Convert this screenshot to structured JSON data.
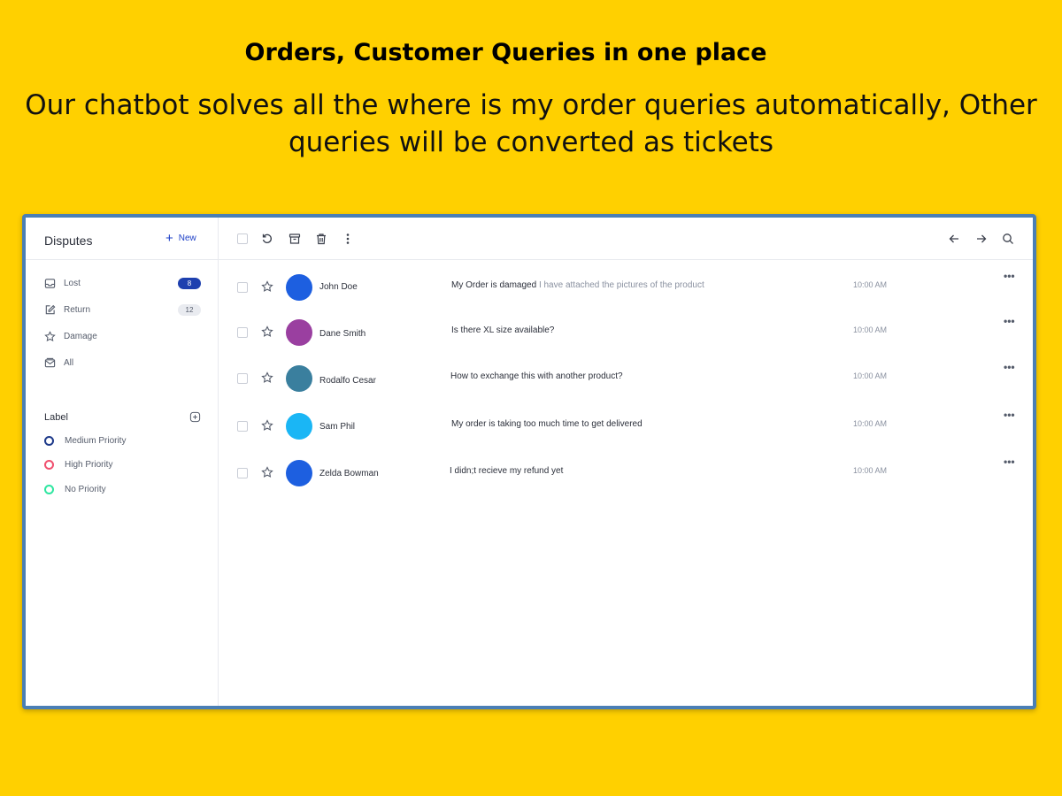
{
  "headline": "Orders, Customer Queries in one place",
  "subline": "Our chatbot solves all the where is my order queries automatically, Other queries will be converted as tickets",
  "sidebar": {
    "title": "Disputes",
    "new_label": "New",
    "folders": [
      {
        "label": "Lost",
        "count": "8",
        "icon": "inbox-icon"
      },
      {
        "label": "Return",
        "count": "12",
        "icon": "edit-icon"
      },
      {
        "label": "Damage",
        "count": "",
        "icon": "star-icon"
      },
      {
        "label": "All",
        "count": "",
        "icon": "all-mail-icon"
      }
    ],
    "label_heading": "Label",
    "labels": [
      {
        "label": "Medium Priority",
        "color": "#1E3A8A"
      },
      {
        "label": "High Priority",
        "color": "#F0506E"
      },
      {
        "label": "No Priority",
        "color": "#2EE6A0"
      }
    ]
  },
  "messages": [
    {
      "name": "John Doe",
      "subject": "My Order is damaged",
      "preview": "I have attached the pictures of the product",
      "time": "10:00 AM",
      "avatar_color": "#1D5FE0"
    },
    {
      "name": "Dane Smith",
      "subject": "Is there XL size available?",
      "preview": "",
      "time": "10:00 AM",
      "avatar_color": "#9A3FA0"
    },
    {
      "name": "Rodalfo Cesar",
      "subject": "How to exchange this with another product?",
      "preview": "",
      "time": "10:00 AM",
      "avatar_color": "#3A7F9E"
    },
    {
      "name": "Sam Phil",
      "subject": "My order is taking too much time to get delivered",
      "preview": "",
      "time": "10:00 AM",
      "avatar_color": "#1AB6F5"
    },
    {
      "name": "Zelda Bowman",
      "subject": "I didn;t recieve my refund yet",
      "preview": "",
      "time": "10:00 AM",
      "avatar_color": "#1D5FE0"
    }
  ],
  "more_glyph": "•••"
}
